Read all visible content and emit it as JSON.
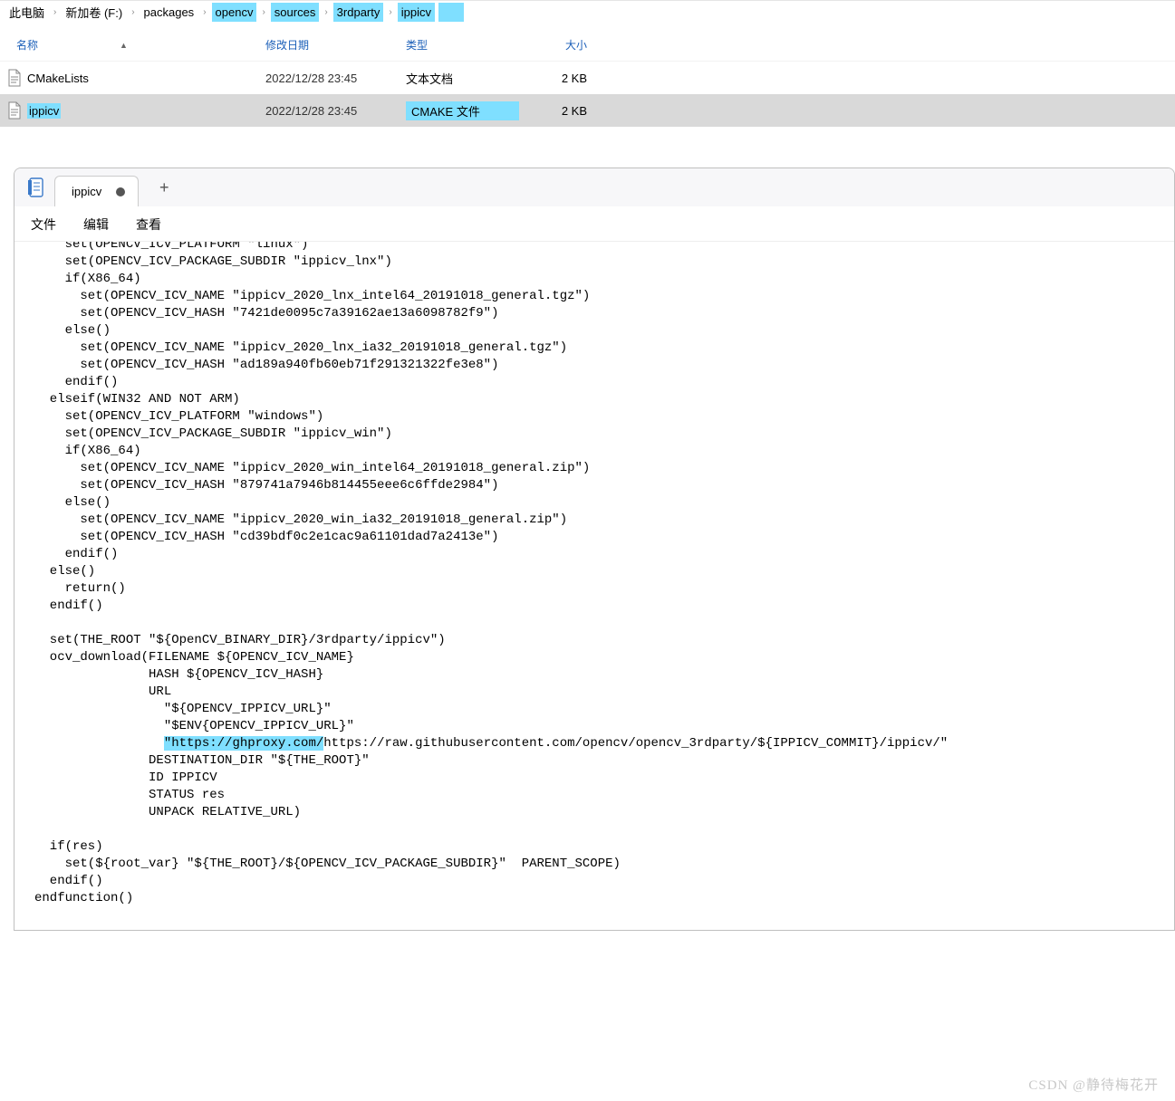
{
  "breadcrumb": {
    "items": [
      {
        "label": "此电脑",
        "highlight": false
      },
      {
        "label": "新加卷 (F:)",
        "highlight": false
      },
      {
        "label": "packages",
        "highlight": false
      },
      {
        "label": "opencv",
        "highlight": true
      },
      {
        "label": "sources",
        "highlight": true
      },
      {
        "label": "3rdparty",
        "highlight": true
      },
      {
        "label": "ippicv",
        "highlight": true
      }
    ]
  },
  "list_header": {
    "name": "名称",
    "date": "修改日期",
    "type": "类型",
    "size": "大小"
  },
  "rows": [
    {
      "name": "CMakeLists",
      "date": "2022/12/28 23:45",
      "type": "文本文档",
      "size": "2 KB",
      "selected": false,
      "name_hl": false,
      "type_hl": false
    },
    {
      "name": "ippicv",
      "date": "2022/12/28 23:45",
      "type": "CMAKE 文件",
      "size": "2 KB",
      "selected": true,
      "name_hl": true,
      "type_hl": true
    }
  ],
  "editor": {
    "tab_title": "ippicv",
    "menu": {
      "file": "文件",
      "edit": "编辑",
      "view": "查看"
    },
    "code_lines": [
      {
        "t": "    set(OPENCV_ICV_PLATFORM \"linux\")",
        "cut": true
      },
      {
        "t": "    set(OPENCV_ICV_PACKAGE_SUBDIR \"ippicv_lnx\")"
      },
      {
        "t": "    if(X86_64)"
      },
      {
        "t": "      set(OPENCV_ICV_NAME \"ippicv_2020_lnx_intel64_20191018_general.tgz\")"
      },
      {
        "t": "      set(OPENCV_ICV_HASH \"7421de0095c7a39162ae13a6098782f9\")"
      },
      {
        "t": "    else()"
      },
      {
        "t": "      set(OPENCV_ICV_NAME \"ippicv_2020_lnx_ia32_20191018_general.tgz\")"
      },
      {
        "t": "      set(OPENCV_ICV_HASH \"ad189a940fb60eb71f291321322fe3e8\")"
      },
      {
        "t": "    endif()"
      },
      {
        "t": "  elseif(WIN32 AND NOT ARM)"
      },
      {
        "t": "    set(OPENCV_ICV_PLATFORM \"windows\")"
      },
      {
        "t": "    set(OPENCV_ICV_PACKAGE_SUBDIR \"ippicv_win\")"
      },
      {
        "t": "    if(X86_64)"
      },
      {
        "t": "      set(OPENCV_ICV_NAME \"ippicv_2020_win_intel64_20191018_general.zip\")"
      },
      {
        "t": "      set(OPENCV_ICV_HASH \"879741a7946b814455eee6c6ffde2984\")"
      },
      {
        "t": "    else()"
      },
      {
        "t": "      set(OPENCV_ICV_NAME \"ippicv_2020_win_ia32_20191018_general.zip\")"
      },
      {
        "t": "      set(OPENCV_ICV_HASH \"cd39bdf0c2e1cac9a61101dad7a2413e\")"
      },
      {
        "t": "    endif()"
      },
      {
        "t": "  else()"
      },
      {
        "t": "    return()"
      },
      {
        "t": "  endif()"
      },
      {
        "t": ""
      },
      {
        "t": "  set(THE_ROOT \"${OpenCV_BINARY_DIR}/3rdparty/ippicv\")"
      },
      {
        "t": "  ocv_download(FILENAME ${OPENCV_ICV_NAME}"
      },
      {
        "t": "               HASH ${OPENCV_ICV_HASH}"
      },
      {
        "t": "               URL"
      },
      {
        "t": "                 \"${OPENCV_IPPICV_URL}\""
      },
      {
        "t": "                 \"$ENV{OPENCV_IPPICV_URL}\""
      },
      {
        "pre": "                 ",
        "hl": "\"https://ghproxy.com/",
        "post": "https://raw.githubusercontent.com/opencv/opencv_3rdparty/${IPPICV_COMMIT}/ippicv/\""
      },
      {
        "t": "               DESTINATION_DIR \"${THE_ROOT}\""
      },
      {
        "t": "               ID IPPICV"
      },
      {
        "t": "               STATUS res"
      },
      {
        "t": "               UNPACK RELATIVE_URL)"
      },
      {
        "t": ""
      },
      {
        "t": "  if(res)"
      },
      {
        "t": "    set(${root_var} \"${THE_ROOT}/${OPENCV_ICV_PACKAGE_SUBDIR}\"  PARENT_SCOPE)"
      },
      {
        "t": "  endif()"
      },
      {
        "t": "endfunction()"
      }
    ]
  },
  "watermark": "CSDN @静待梅花开"
}
